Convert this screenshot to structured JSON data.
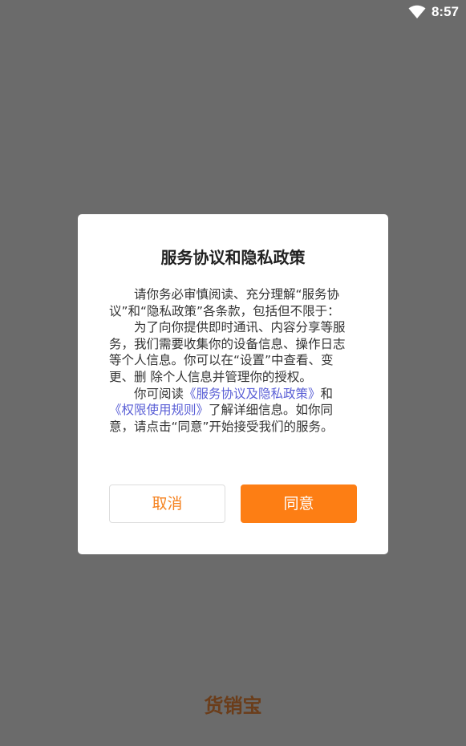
{
  "status_bar": {
    "time": "8:57",
    "wifi_icon": "wifi-icon"
  },
  "dialog": {
    "title": "服务协议和隐私政策",
    "para1": "请你务必审慎阅读、充分理解“服务协议”和“隐私政策”各条款，包括但不限于：",
    "para2": "为了向你提供即时通讯、内容分享等服务，我们需要收集你的设备信息、操作日志等个人信息。你可以在“设置”中查看、变更、删 除个人信息并管理你的授权。",
    "para3_prefix": "你可阅读",
    "link_service_privacy": "《服务协议及隐私政策》",
    "para3_and": "和",
    "link_permission_rules": "《权限使用规则》",
    "para3_suffix": "了解详细信息。如你同意，请点击“同意”开始接受我们的服务。",
    "cancel_label": "取消",
    "agree_label": "同意"
  },
  "brand": {
    "logo_text": "货销宝"
  },
  "colors": {
    "overlay": "#6b6b6b",
    "accent": "#fd7e14",
    "link": "#5a5fd6",
    "brand": "#6b3d1a"
  }
}
